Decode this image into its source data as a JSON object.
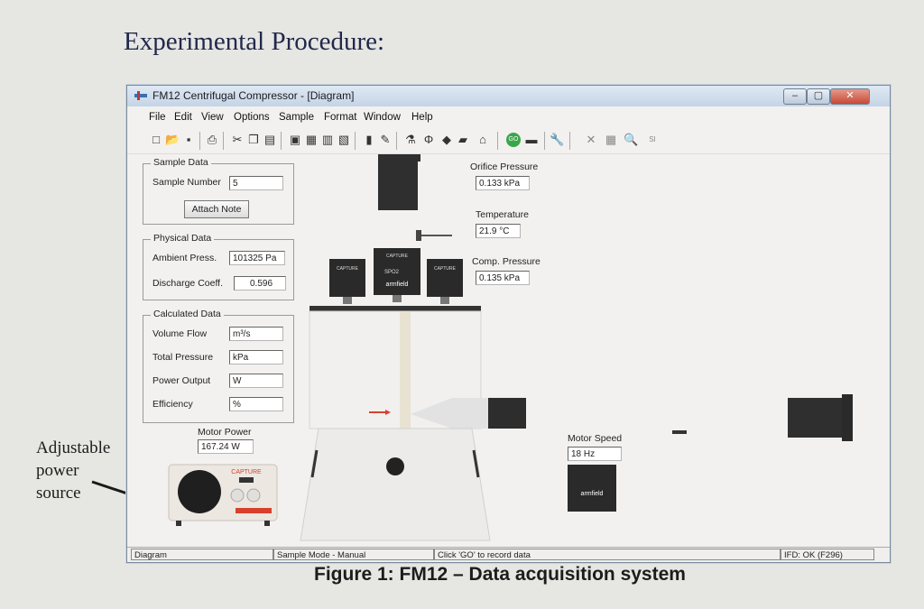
{
  "page": {
    "heading": "Experimental Procedure:",
    "side_note": [
      "Adjustable",
      "power",
      "source"
    ],
    "caption": "Figure 1: FM12 – Data acquisition system"
  },
  "window": {
    "title": "FM12 Centrifugal Compressor - [Diagram]",
    "controls": [
      "minimize",
      "maximize",
      "close"
    ]
  },
  "menu": [
    "File",
    "Edit",
    "View",
    "Options",
    "Sample",
    "Format",
    "Window",
    "Help"
  ],
  "toolbar_icons": [
    "new-icon",
    "open-icon",
    "save-icon",
    "print-icon",
    "cut-icon",
    "copy-icon",
    "paste-icon",
    "diagram-icon",
    "graph-icon",
    "table-icon",
    "chart-icon",
    "bar-chart-icon",
    "pencil-chart-icon",
    "flask-icon",
    "phi-icon",
    "paint-icon",
    "book-icon",
    "home-icon",
    "go-icon",
    "record-icon",
    "wrench-icon",
    "delete-icon",
    "table-grid-icon",
    "zoom-icon",
    "units-icon"
  ],
  "sample_data": {
    "title": "Sample Data",
    "sample_number_label": "Sample Number",
    "sample_number": "5",
    "attach_note": "Attach Note"
  },
  "physical_data": {
    "title": "Physical Data",
    "ambient_label": "Ambient Press.",
    "ambient_value": "101325 Pa",
    "discharge_label": "Discharge Coeff.",
    "discharge_value": "0.596"
  },
  "calculated_data": {
    "title": "Calculated Data",
    "rows": [
      {
        "label": "Volume Flow",
        "unit": "m³/s"
      },
      {
        "label": "Total Pressure",
        "unit": "kPa"
      },
      {
        "label": "Power Output",
        "unit": "W"
      },
      {
        "label": "Efficiency",
        "unit": "%"
      }
    ]
  },
  "readouts": {
    "orifice_label": "Orifice Pressure",
    "orifice_value": "0.133 kPa",
    "temperature_label": "Temperature",
    "temperature_value": "21.9 °C",
    "comp_label": "Comp. Pressure",
    "comp_value": "0.135 kPa",
    "motor_power_label": "Motor Power",
    "motor_power_value": "167.24 W",
    "motor_speed_label": "Motor Speed",
    "motor_speed_value": "18 Hz"
  },
  "devices": {
    "capture": "CAPTURE",
    "armfield": "armfield",
    "sensor_left": "SPO2"
  },
  "status": [
    "Diagram",
    "Sample Mode - Manual",
    "Click 'GO' to record data",
    "IFD: OK (F296)"
  ],
  "colors": {
    "accent_red": "#d8402e",
    "dark_equipment": "#2b2b2b",
    "go_green": "#3aa64a"
  }
}
